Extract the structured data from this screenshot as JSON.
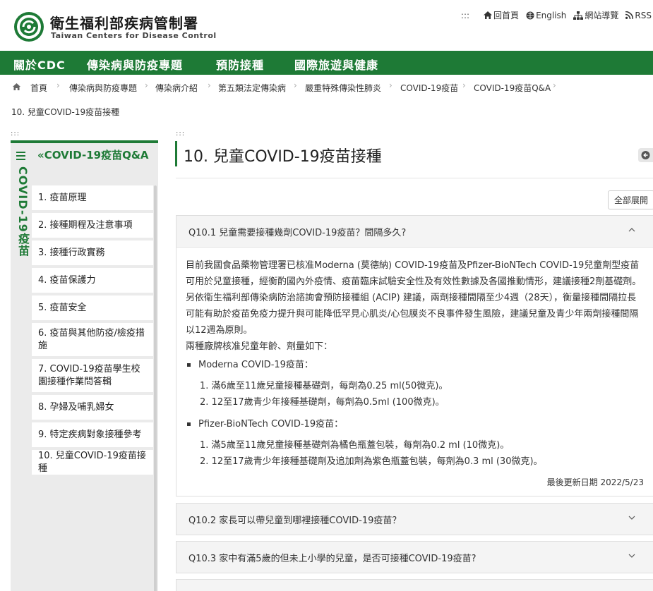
{
  "header": {
    "org_name_zh": "衛生福利部疾病管制署",
    "org_name_en": "Taiwan Centers for Disease Control",
    "accesskey": ":::",
    "links": [
      {
        "label": "回首頁",
        "icon": "home-icon"
      },
      {
        "label": "English",
        "icon": "globe-icon"
      },
      {
        "label": "網站導覽",
        "icon": "sitemap-icon"
      },
      {
        "label": "RSS",
        "icon": "rss-icon"
      }
    ]
  },
  "nav": {
    "items": [
      "關於CDC",
      "傳染病與防疫專題",
      "預防接種",
      "國際旅遊與健康"
    ]
  },
  "breadcrumb": {
    "items": [
      "首頁",
      "傳染病與防疫專題",
      "傳染病介紹",
      "第五類法定傳染病",
      "嚴重特殊傳染性肺炎",
      "COVID-19疫苗",
      "COVID-19疫苗Q&A"
    ],
    "current": "10. 兒童COVID-19疫苗接種"
  },
  "sidebar": {
    "accesskey": ":::",
    "vertical_title": "COVID-19疫苗",
    "section_title": "«COVID-19疫苗Q&A",
    "items": [
      "1. 疫苗原理",
      "2. 接種期程及注意事項",
      "3. 接種行政實務",
      "4. 疫苗保護力",
      "5. 疫苗安全",
      "6. 疫苗與其他防疫/檢疫措施",
      "7. COVID-19疫苗學生校園接種作業問答輯",
      "8. 孕婦及哺乳婦女",
      "9. 特定疾病對象接種參考",
      "10. 兒童COVID-19疫苗接種"
    ]
  },
  "content": {
    "accesskey": ":::",
    "title": "10. 兒童COVID-19疫苗接種",
    "expand_all_label": "全部展開",
    "questions": [
      {
        "q": "Q10.1 兒童需要接種幾劑COVID-19疫苗？間隔多久?",
        "expanded": true,
        "answer": {
          "p1": "目前我國食品藥物管理署已核准Moderna (莫德納) COVID-19疫苗及Pfizer-BioNTech COVID-19兒童劑型疫苗可用於兒童接種，經衡酌國內外疫情、疫苗臨床試驗安全性及有效性數據及各國推動情形，建議接種2劑基礎劑。",
          "p2": "另依衛生福利部傳染病防治諮詢會預防接種組 (ACIP) 建議，兩劑接種間隔至少4週（28天），衡量接種間隔拉長可能有助於疫苗免疫力提升與可能降低罕見心肌炎/心包膜炎不良事件發生風險，建議兒童及青少年兩劑接種間隔以12週為原則。",
          "p3": "兩種廠牌核准兒童年齡、劑量如下：",
          "brands": [
            {
              "name": "Moderna COVID-19疫苗：",
              "doses": [
                "滿6歲至11歲兒童接種基礎劑，每劑為0.25 ml(50微克)。",
                "12至17歲青少年接種基礎劑，每劑為0.5ml (100微克)。"
              ]
            },
            {
              "name": "Pfizer-BioNTech COVID-19疫苗：",
              "doses": [
                "滿5歲至11歲兒童接種基礎劑為橘色瓶蓋包裝，每劑為0.2 ml (10微克)。",
                "12至17歲青少年接種基礎劑及追加劑為紫色瓶蓋包裝，每劑為0.3 ml (30微克)。"
              ]
            }
          ],
          "updated": "最後更新日期 2022/5/23"
        }
      },
      {
        "q": "Q10.2 家長可以帶兒童到哪裡接種COVID-19疫苗？",
        "expanded": false
      },
      {
        "q": "Q10.3 家中有滿5歲的但未上小學的兒童，是否可接種COVID-19疫苗?",
        "expanded": false
      }
    ]
  },
  "colors": {
    "brand_green": "#1e7a36",
    "sidebar_bg": "#ebebeb",
    "qa_head_bg": "#f4f4f4"
  }
}
